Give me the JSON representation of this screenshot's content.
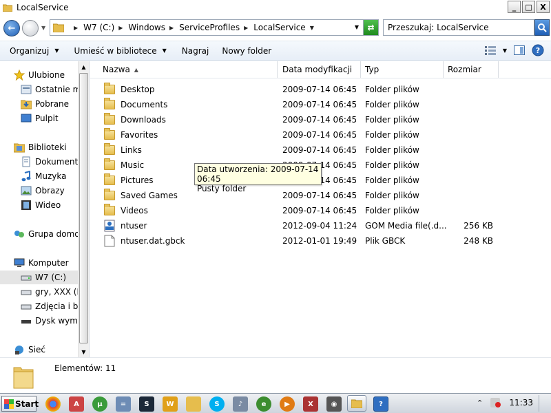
{
  "window": {
    "title": "LocalService",
    "controls": {
      "minimize": "_",
      "maximize": "□",
      "close": "X"
    }
  },
  "address": {
    "crumbs": [
      "W7 (C:)",
      "Windows",
      "ServiceProfiles",
      "LocalService"
    ],
    "search_placeholder": "Przeszukaj: LocalService"
  },
  "toolbar": {
    "organize": "Organizuj",
    "include_library": "Umieść w bibliotece",
    "burn": "Nagraj",
    "new_folder": "Nowy folder"
  },
  "nav": {
    "favorites": {
      "label": "Ulubione",
      "items": [
        "Ostatnie miejsca",
        "Pobrane",
        "Pulpit"
      ]
    },
    "libraries": {
      "label": "Biblioteki",
      "items": [
        "Dokumenty",
        "Muzyka",
        "Obrazy",
        "Wideo"
      ]
    },
    "homegroup": "Grupa domowa",
    "computer": {
      "label": "Komputer",
      "items": [
        "W7 (C:)",
        "gry, XXX (E:)",
        "Zdjęcia i bajki",
        "Dysk wymienny"
      ]
    },
    "network": "Sieć"
  },
  "columns": {
    "name": "Nazwa",
    "modified": "Data modyfikacji",
    "type": "Typ",
    "size": "Rozmiar"
  },
  "files": [
    {
      "name": "Desktop",
      "modified": "2009-07-14 06:45",
      "type": "Folder plików",
      "size": "",
      "icon": "folder-icon"
    },
    {
      "name": "Documents",
      "modified": "2009-07-14 06:45",
      "type": "Folder plików",
      "size": "",
      "icon": "folder-icon"
    },
    {
      "name": "Downloads",
      "modified": "2009-07-14 06:45",
      "type": "Folder plików",
      "size": "",
      "icon": "folder-icon"
    },
    {
      "name": "Favorites",
      "modified": "2009-07-14 06:45",
      "type": "Folder plików",
      "size": "",
      "icon": "folder-icon"
    },
    {
      "name": "Links",
      "modified": "2009-07-14 06:45",
      "type": "Folder plików",
      "size": "",
      "icon": "folder-icon"
    },
    {
      "name": "Music",
      "modified": "2009-07-14 06:45",
      "type": "Folder plików",
      "size": "",
      "icon": "folder-icon"
    },
    {
      "name": "Pictures",
      "modified": "2009-07-14 06:45",
      "type": "Folder plików",
      "size": "",
      "icon": "folder-icon"
    },
    {
      "name": "Saved Games",
      "modified": "2009-07-14 06:45",
      "type": "Folder plików",
      "size": "",
      "icon": "folder-icon"
    },
    {
      "name": "Videos",
      "modified": "2009-07-14 06:45",
      "type": "Folder plików",
      "size": "",
      "icon": "folder-icon"
    },
    {
      "name": "ntuser",
      "modified": "2012-09-04 11:24",
      "type": "GOM Media file(.d...",
      "size": "256 KB",
      "icon": "dat-file-icon"
    },
    {
      "name": "ntuser.dat.gbck",
      "modified": "2012-01-01 19:49",
      "type": "Plik GBCK",
      "size": "248 KB",
      "icon": "blank-file-icon"
    }
  ],
  "tooltip": {
    "line1": "Data utworzenia: 2009-07-14 06:45",
    "line2": "Pusty folder"
  },
  "status": {
    "count": "Elementów: 11"
  },
  "taskbar": {
    "start": "Start",
    "clock": "11:33"
  },
  "colors": {
    "folder": "#e6bd4d",
    "toolbar_bg": "#e7eef7",
    "tooltip_bg": "#ffffe1",
    "selected_nav": "#e5e5e5"
  }
}
